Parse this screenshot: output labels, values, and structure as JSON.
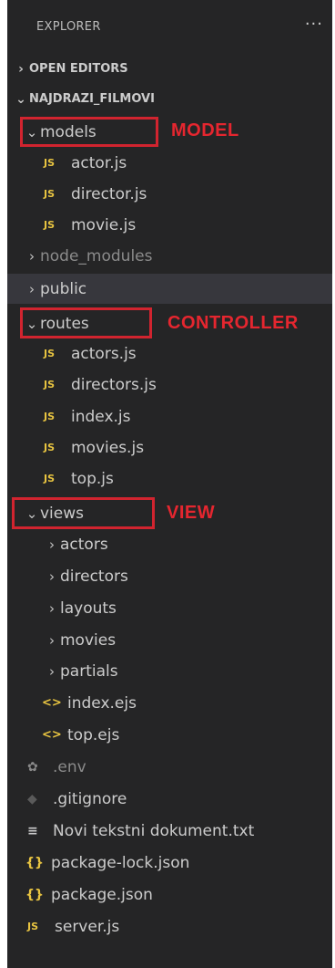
{
  "header": {
    "title": "EXPLORER",
    "more": "···"
  },
  "sections": {
    "open_editors": "OPEN EDITORS",
    "project": "NAJDRAZI_FILMOVI"
  },
  "tree": {
    "models": "models",
    "actor_js": "actor.js",
    "director_js": "director.js",
    "movie_js": "movie.js",
    "node_modules": "node_modules",
    "public": "public",
    "routes": "routes",
    "actors_js": "actors.js",
    "directors_js": "directors.js",
    "index_js": "index.js",
    "movies_js": "movies.js",
    "top_js": "top.js",
    "views": "views",
    "actors": "actors",
    "directors": "directors",
    "layouts": "layouts",
    "movies": "movies",
    "partials": "partials",
    "index_ejs": "index.ejs",
    "top_ejs": "top.ejs",
    "env": ".env",
    "gitignore": ".gitignore",
    "novi_txt": "Novi tekstni dokument.txt",
    "package_lock": "package-lock.json",
    "package_json": "package.json",
    "server_js": "server.js"
  },
  "icons": {
    "chevron_right": "›",
    "chevron_down": "⌄",
    "js": "JS",
    "ejs": "<>",
    "json": "{}",
    "env": "✿",
    "git": "◆",
    "txt": "≡"
  },
  "annotations": {
    "model": "MODEL",
    "controller": "CONTROLLER",
    "view": "VIEW"
  },
  "colors": {
    "panel_bg": "#252526",
    "js_icon": "#e8c441",
    "annotation_red": "#e5262f",
    "box_red": "#d1242f"
  }
}
